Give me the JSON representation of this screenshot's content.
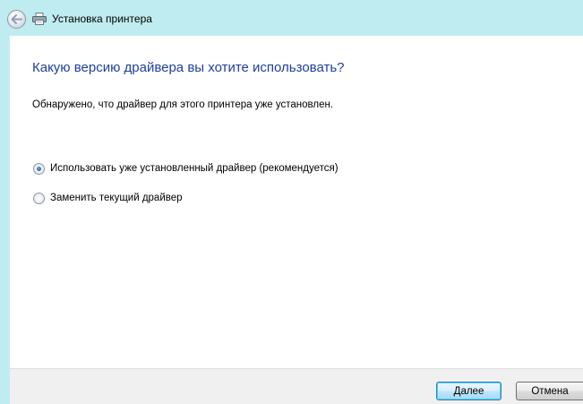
{
  "window": {
    "title": "Установка принтера",
    "icons": {
      "back": "back-arrow-icon",
      "title": "printer-icon"
    }
  },
  "main": {
    "heading": "Какую версию драйвера вы хотите использовать?",
    "description": "Обнаружено, что драйвер для этого принтера уже установлен.",
    "options": [
      {
        "label": "Использовать уже установленный драйвер (рекомендуется)",
        "selected": true
      },
      {
        "label": "Заменить текущий драйвер",
        "selected": false
      }
    ]
  },
  "footer": {
    "next_label": "Далее",
    "cancel_label": "Отмена"
  },
  "colors": {
    "frame": "#bfecf0",
    "heading": "#1e3e9e",
    "content_bg": "#ffffff",
    "footer_bg": "#f0f0f0"
  }
}
